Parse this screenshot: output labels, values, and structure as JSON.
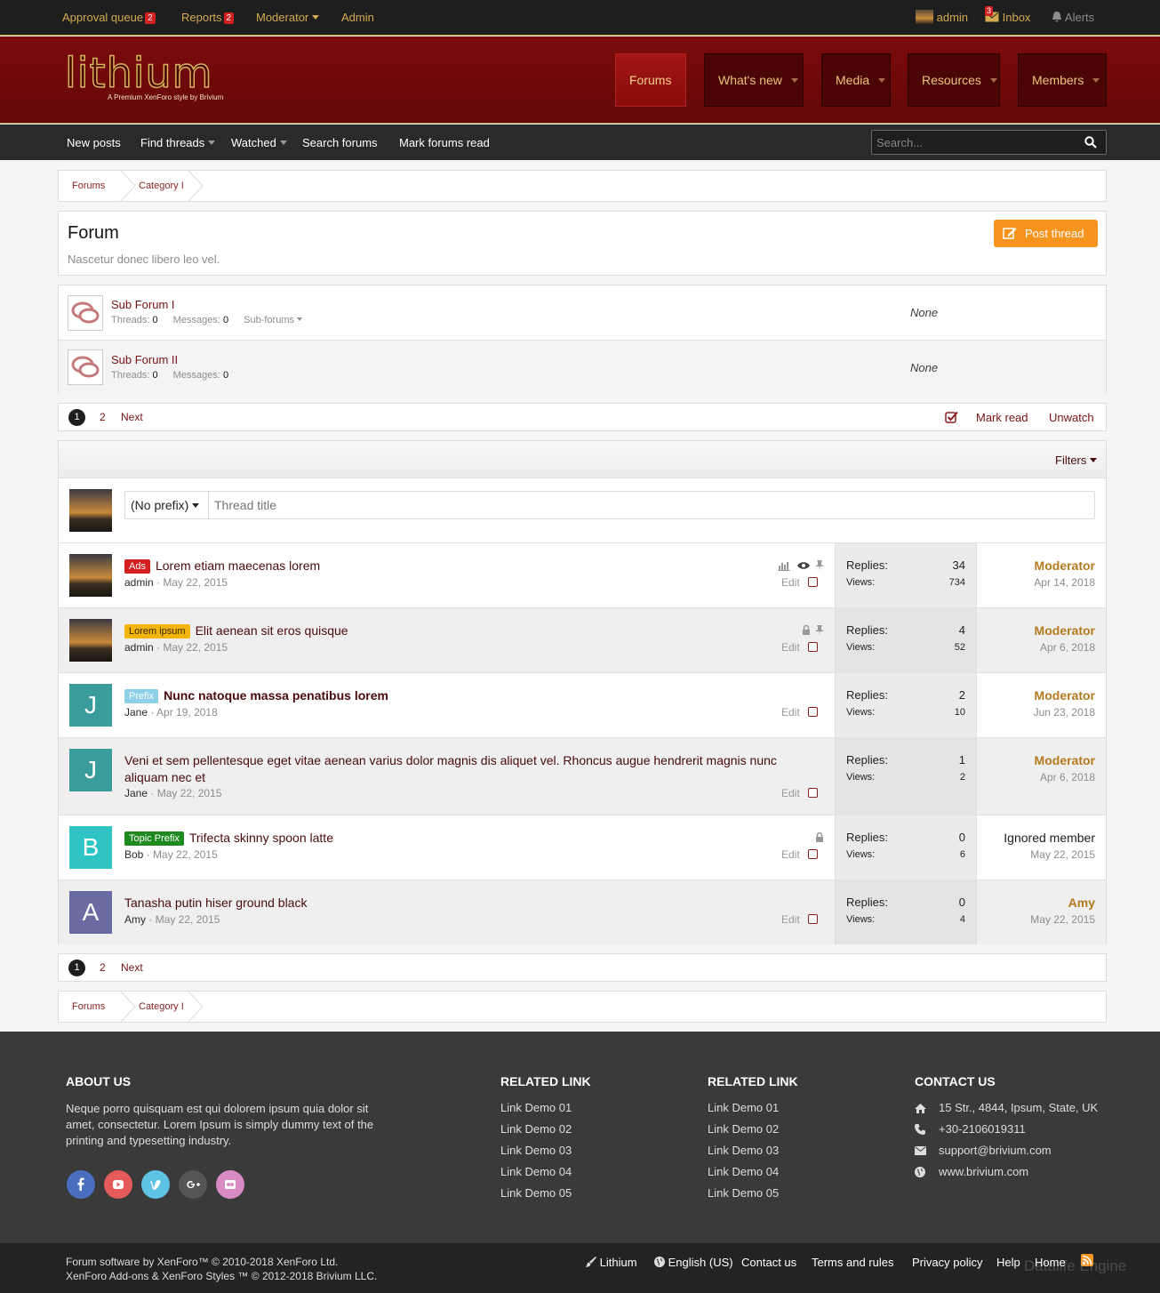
{
  "staffbar": {
    "approval_queue": "Approval queue",
    "approval_count": "2",
    "reports": "Reports",
    "reports_count": "2",
    "moderator": "Moderator",
    "admin": "Admin",
    "user": "admin",
    "inbox": "Inbox",
    "inbox_count": "3",
    "alerts": "Alerts"
  },
  "header": {
    "logo": "lithium",
    "tagline": "A Premium XenForo style by Brivium",
    "tabs": [
      "Forums",
      "What's new",
      "Media",
      "Resources",
      "Members"
    ]
  },
  "subnav": {
    "items": [
      "New posts",
      "Find threads",
      "Watched",
      "Search forums",
      "Mark forums read"
    ],
    "search_placeholder": "Search..."
  },
  "breadcrumb": [
    "Forums",
    "Category I"
  ],
  "forum": {
    "title": "Forum",
    "description": "Nascetur donec libero leo vel.",
    "post_thread": "Post thread"
  },
  "subforums": [
    {
      "title": "Sub Forum I",
      "threads_label": "Threads:",
      "threads": "0",
      "messages_label": "Messages:",
      "messages": "0",
      "extra": "Sub-forums",
      "last": "None"
    },
    {
      "title": "Sub Forum II",
      "threads_label": "Threads:",
      "threads": "0",
      "messages_label": "Messages:",
      "messages": "0",
      "extra": "",
      "last": "None"
    }
  ],
  "pagination": {
    "current": "1",
    "page2": "2",
    "next": "Next",
    "mark_read": "Mark read",
    "unwatch": "Unwatch"
  },
  "filters": "Filters",
  "quick_thread": {
    "prefix": "(No prefix)",
    "placeholder": "Thread title"
  },
  "labels": {
    "replies": "Replies:",
    "views": "Views:",
    "edit": "Edit"
  },
  "threads": [
    {
      "prefix": "Ads",
      "prefix_bg": "#d21f1f",
      "prefix_fg": "#ffffff",
      "title": "Lorem etiam maecenas lorem",
      "author": "admin",
      "date": "May 22, 2015",
      "replies": "34",
      "views": "734",
      "last_user": "Moderator",
      "last_date": "Apr 14, 2018"
    },
    {
      "prefix": "Lorem ipsum",
      "prefix_bg": "#f3b40c",
      "prefix_fg": "#3a2a00",
      "title": "Elit aenean sit eros quisque",
      "author": "admin",
      "date": "May 22, 2015",
      "replies": "4",
      "views": "52",
      "last_user": "Moderator",
      "last_date": "Apr 6, 2018"
    },
    {
      "prefix": "Prefix",
      "prefix_bg": "#8ccfe6",
      "prefix_fg": "#ffffff",
      "title": "Nunc natoque massa penatibus lorem",
      "author": "Jane",
      "date": "Apr 19, 2018",
      "replies": "2",
      "views": "10",
      "last_user": "Moderator",
      "last_date": "Jun 23, 2018",
      "avatar_letter": "J",
      "avatar_color": "#3b9c9c"
    },
    {
      "prefix": "",
      "title": "Veni et sem pellentesque eget vitae aenean varius dolor magnis dis aliquet vel. Rhoncus augue hendrerit magnis nunc aliquam nec et",
      "author": "Jane",
      "date": "May 22, 2015",
      "replies": "1",
      "views": "2",
      "last_user": "Moderator",
      "last_date": "Apr 6, 2018",
      "avatar_letter": "J",
      "avatar_color": "#3b9c9c"
    },
    {
      "prefix": "Topic Prefix",
      "prefix_bg": "#1f8a1f",
      "prefix_fg": "#ffffff",
      "title": "Trifecta skinny spoon latte",
      "author": "Bob",
      "date": "May 22, 2015",
      "replies": "0",
      "views": "6",
      "last_user": "Ignored member",
      "last_date": "May 22, 2015",
      "avatar_letter": "B",
      "avatar_color": "#2ec4c4"
    },
    {
      "prefix": "",
      "title": "Tanasha putin hiser ground black",
      "author": "Amy",
      "date": "May 22, 2015",
      "replies": "0",
      "views": "4",
      "last_user": "Amy",
      "last_date": "May 22, 2015",
      "avatar_letter": "A",
      "avatar_color": "#6b6ba3"
    }
  ],
  "footer": {
    "about_head": "ABOUT US",
    "about_text": "Neque porro quisquam est qui dolorem ipsum quia dolor sit amet, consectetur. Lorem Ipsum is simply dummy text of the printing and typesetting industry.",
    "related_head": "RELATED LINK",
    "links": [
      "Link Demo 01",
      "Link Demo 02",
      "Link Demo 03",
      "Link Demo 04",
      "Link Demo 05"
    ],
    "contact_head": "CONTACT US",
    "address": "15 Str., 4844, Ipsum, State, UK",
    "phone": "+30-2106019311",
    "email": "support@brivium.com",
    "web": "www.brivium.com",
    "social": [
      {
        "icon": "facebook-icon",
        "color": "#4a6fbf"
      },
      {
        "icon": "youtube-icon",
        "color": "#e55b5b"
      },
      {
        "icon": "vimeo-icon",
        "color": "#5fc3e6"
      },
      {
        "icon": "google-plus-icon",
        "color": "#555555"
      },
      {
        "icon": "flickr-icon",
        "color": "#d98cc4"
      }
    ]
  },
  "copyright": {
    "line1": "Forum software by XenForo™ © 2010-2018 XenForo Ltd.",
    "line2": "XenForo Add-ons & XenForo Styles ™ © 2012-2018 Brivium LLC.",
    "links": [
      "Lithium",
      "English (US)",
      "Contact us",
      "Terms and rules",
      "Privacy policy",
      "Help",
      "Home"
    ],
    "watermark": "Datalife Engine"
  },
  "colors": {
    "brand": "#7b0b0b",
    "accent": "#f7941d",
    "gold": "#d4aa50"
  }
}
